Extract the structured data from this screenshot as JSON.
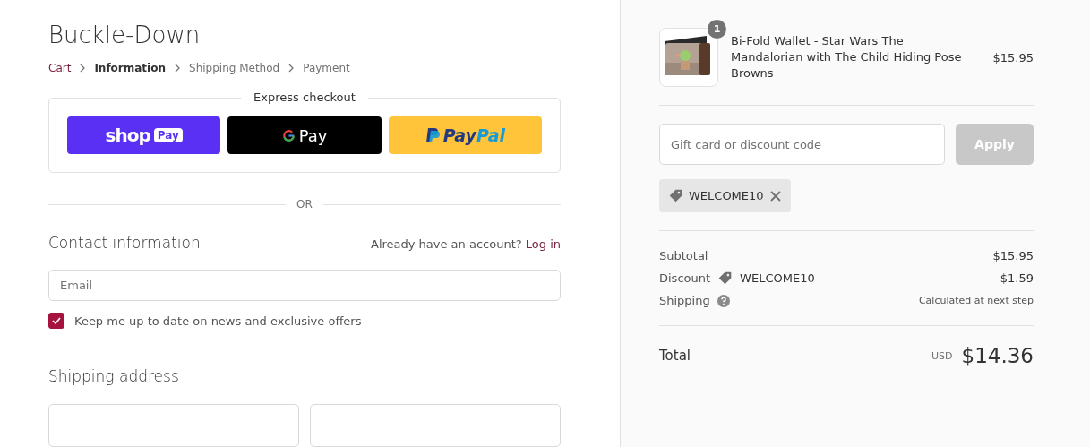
{
  "store": {
    "name": "Buckle-Down"
  },
  "breadcrumbs": [
    {
      "label": "Cart",
      "kind": "link"
    },
    {
      "label": "Information",
      "kind": "current"
    },
    {
      "label": "Shipping Method",
      "kind": "pending"
    },
    {
      "label": "Payment",
      "kind": "pending"
    }
  ],
  "express_checkout": {
    "title": "Express checkout",
    "buttons": [
      {
        "kind": "shop",
        "label": "shop",
        "badge": "Pay"
      },
      {
        "kind": "gpay",
        "label": "Pay"
      },
      {
        "kind": "paypal",
        "label": "Pay",
        "label2": "Pal"
      }
    ]
  },
  "divider": "OR",
  "contact": {
    "title": "Contact information",
    "account_prompt": "Already have an account?",
    "login_link": "Log in",
    "email": {
      "placeholder": "Email"
    },
    "newsletter": {
      "label": "Keep me up to date on news and exclusive offers",
      "checked": true
    }
  },
  "shipping_address": {
    "title": "Shipping address"
  },
  "order": {
    "items": [
      {
        "quantity": "1",
        "name": "Bi-Fold Wallet - Star Wars The Mandalorian with The Child Hiding Pose Browns",
        "price": "$15.95"
      }
    ],
    "discount_field": {
      "placeholder": "Gift card or discount code"
    },
    "apply_button": {
      "label": "Apply",
      "disabled": true
    },
    "applied_code": "WELCOME10",
    "subtotal": {
      "label": "Subtotal",
      "value": "$15.95"
    },
    "discount": {
      "label": "Discount",
      "code": "WELCOME10",
      "value": "- $1.59"
    },
    "shipping": {
      "label": "Shipping",
      "value": "Calculated at next step"
    },
    "total": {
      "label": "Total",
      "currency": "USD",
      "value": "$14.36"
    }
  }
}
